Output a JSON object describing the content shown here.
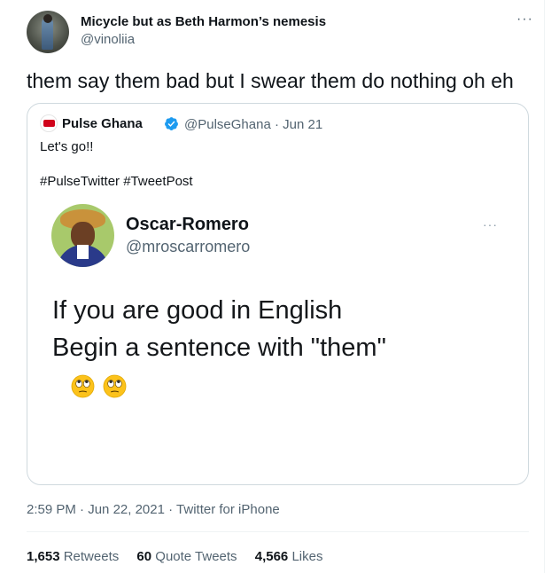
{
  "tweet": {
    "author_name": "Micycle but as Beth Harmon’s nemesis",
    "author_handle": "@vinoliia",
    "more_icon": "ellipsis-icon",
    "text": "them say them bad but I swear them do nothing oh eh",
    "timestamp": "2:59 PM",
    "date": "Jun 22, 2021",
    "source": "Twitter for iPhone"
  },
  "quote": {
    "author_name": "Pulse Ghana",
    "author_handle": "@PulseGhana",
    "date": "Jun 21",
    "text_line1": "Let's go!!",
    "text_line2": "#PulseTwitter #TweetPost",
    "verified_color": "#1d9bf0",
    "image": {
      "author_name": "Oscar-Romero",
      "author_handle": "@mroscarromero",
      "line1": "If you are good in English",
      "line2": "Begin a sentence with \"them\"",
      "emoji": "face-with-rolling-eyes"
    }
  },
  "stats": {
    "retweets_count": "1,653",
    "retweets_label": "Retweets",
    "quotes_count": "60",
    "quotes_label": "Quote Tweets",
    "likes_count": "4,566",
    "likes_label": "Likes"
  }
}
